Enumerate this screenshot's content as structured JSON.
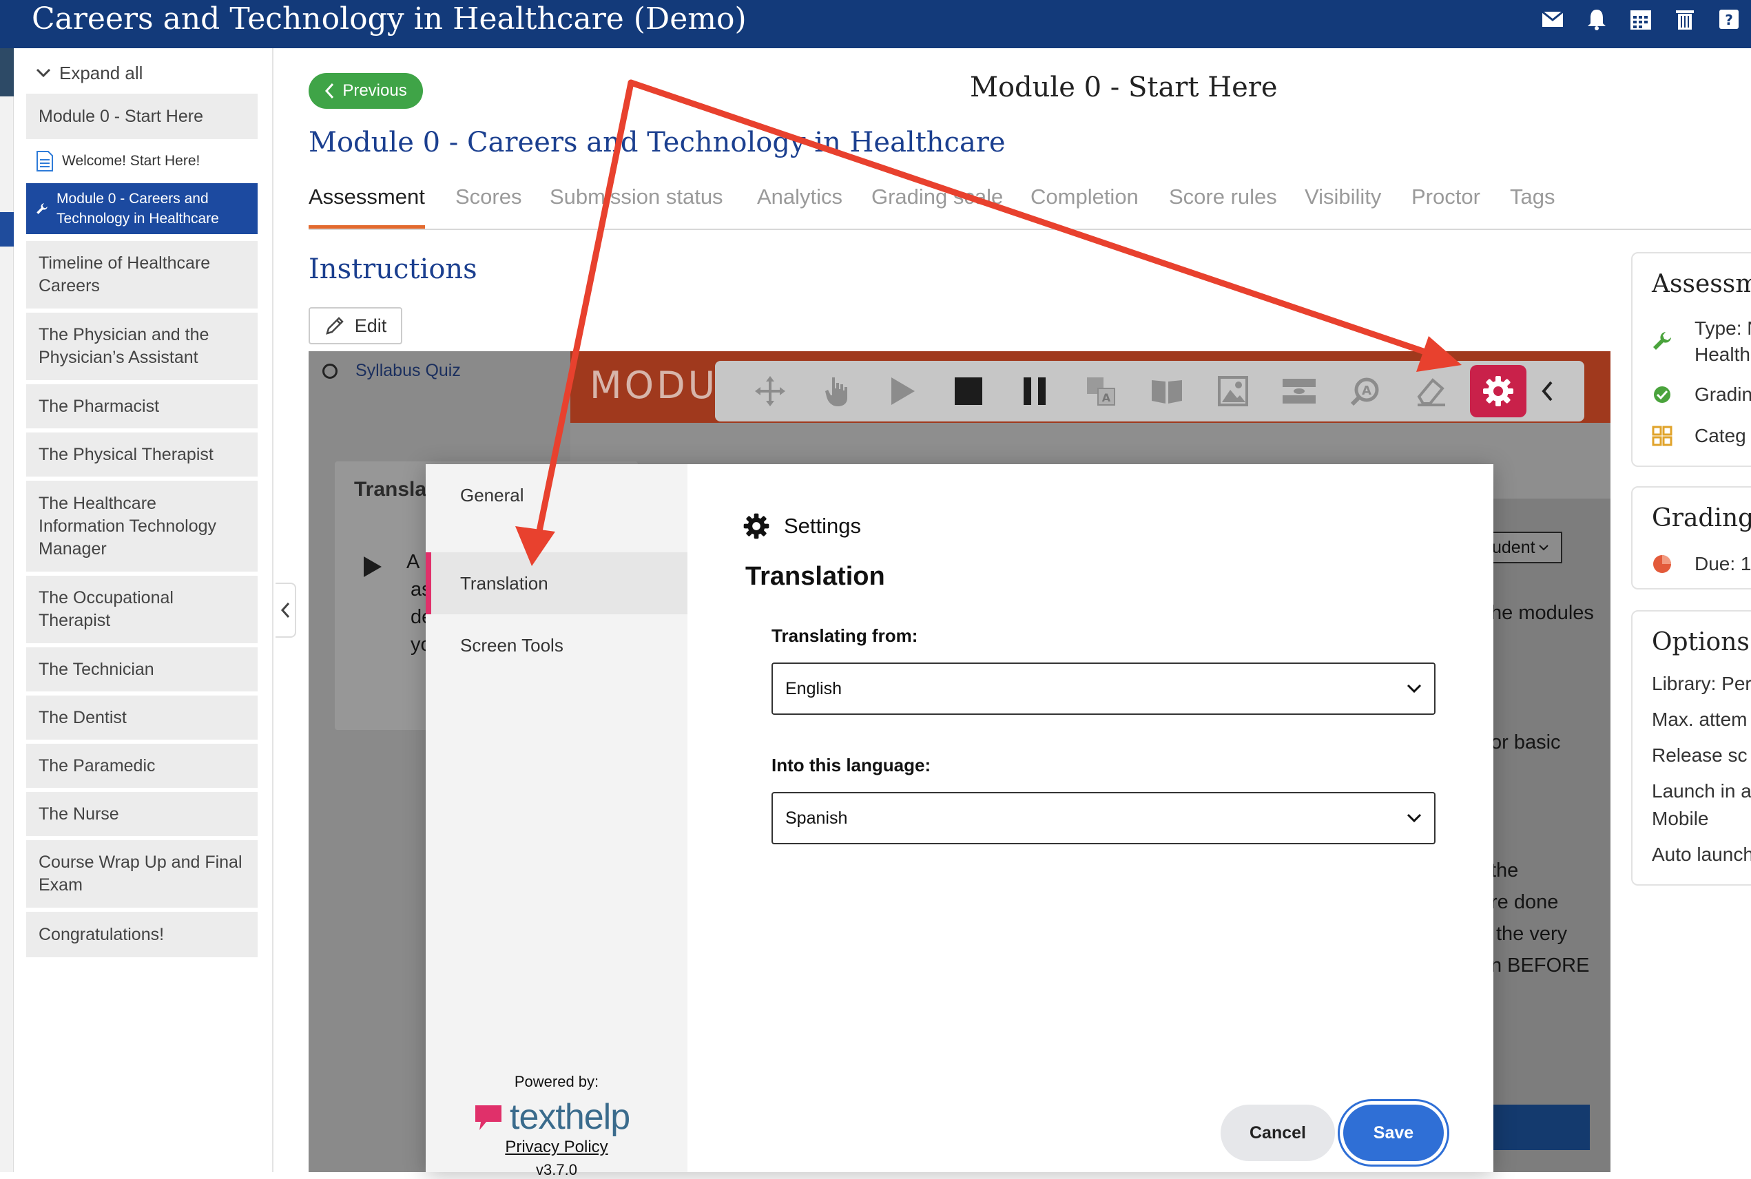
{
  "header": {
    "title": "Careers and Technology in Healthcare (Demo)",
    "icons": [
      "mail-icon",
      "bell-icon",
      "calendar-icon",
      "trash-icon",
      "help-icon"
    ]
  },
  "sidebar": {
    "expand_all": "Expand all",
    "module_item": "Module 0 - Start Here",
    "sub_welcome": "Welcome! Start Here!",
    "sub_active": "Module 0 - Careers and Technology in Healthcare",
    "items": [
      "Timeline of Healthcare Careers",
      "The Physician and the Physician’s Assistant",
      "The Pharmacist",
      "The Physical Therapist",
      "The Healthcare Information Technology Manager",
      "The Occupational Therapist",
      "The Technician",
      "The Dentist",
      "The Paramedic",
      "The Nurse",
      "Course Wrap Up and Final Exam",
      "Congratulations!"
    ]
  },
  "main": {
    "previous_label": "Previous",
    "module_header": "Module 0 - Start Here",
    "assessment_title": "Module 0 - Careers and Technology in Healthcare",
    "tabs": [
      "Assessment",
      "Scores",
      "Submission status",
      "Analytics",
      "Grading scale",
      "Completion",
      "Score rules",
      "Visibility",
      "Proctor",
      "Tags"
    ],
    "instructions_title": "Instructions",
    "edit_label": "Edit"
  },
  "content": {
    "quiz_item": "Syllabus Quiz",
    "banner_text": "MODU",
    "translate_card_title": "Transla",
    "fragments": [
      "A",
      "as",
      "de",
      "yo",
      "udent",
      "he modules",
      "or basic",
      "the",
      "re done",
      "the very",
      "n BEFORE"
    ]
  },
  "modal": {
    "nav": [
      "General",
      "Translation",
      "Screen Tools"
    ],
    "active_nav": "Translation",
    "settings_label": "Settings",
    "section_title": "Translation",
    "from_label": "Translating from:",
    "from_value": "English",
    "into_label": "Into this language:",
    "into_value": "Spanish",
    "powered_by": "Powered by:",
    "brand": "texthelp",
    "privacy": "Privacy Policy",
    "version": "v3.7.0",
    "cancel": "Cancel",
    "save": "Save"
  },
  "right_panel": {
    "assessment_title": "Assessm",
    "type_line1": "Type: N",
    "type_line2": "Health",
    "grading_line": "Gradin",
    "category_line": "Categ",
    "grading_title": "Grading",
    "due_line": "Due: 1",
    "options_title": "Options",
    "options": [
      "Library: Per",
      "Max. attem",
      "Release sc",
      "Launch in a",
      "Mobile",
      "Auto launch"
    ]
  },
  "colors": {
    "header_bg": "#133a7a",
    "active_blue": "#1c4aa0",
    "previous_green": "#3fa447",
    "tab_accent": "#e36a2e",
    "gear_red": "#c9214a",
    "save_blue": "#2f6fd6",
    "arrow_red": "#e8412e"
  }
}
